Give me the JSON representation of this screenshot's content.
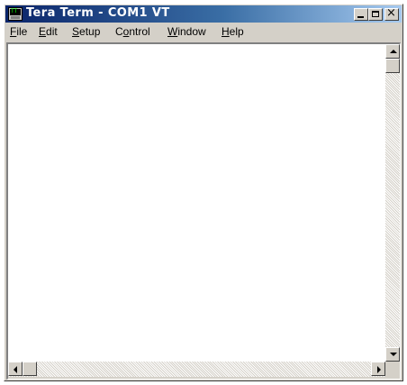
{
  "window": {
    "title": "Tera Term - COM1 VT",
    "icon": "teraterm-app-icon"
  },
  "controls": {
    "minimize_icon": "minimize-icon",
    "maximize_icon": "maximize-icon",
    "close_glyph": "×"
  },
  "menu": {
    "file": {
      "mnemonic": "F",
      "rest": "ile"
    },
    "edit": {
      "mnemonic": "E",
      "rest": "dit"
    },
    "setup": {
      "mnemonic": "S",
      "rest": "etup"
    },
    "control": {
      "pre": "C",
      "mnemonic": "o",
      "rest": "ntrol"
    },
    "window": {
      "mnemonic": "W",
      "rest": "indow"
    },
    "help": {
      "mnemonic": "H",
      "rest": "elp"
    }
  },
  "terminal": {
    "content": ""
  },
  "scrollbars": {
    "vertical_position": 0,
    "horizontal_position": 0
  },
  "colors": {
    "titlebar_start": "#0a246a",
    "titlebar_end": "#a6caf0",
    "chrome": "#d4d0c8",
    "terminal_bg": "#ffffff"
  }
}
